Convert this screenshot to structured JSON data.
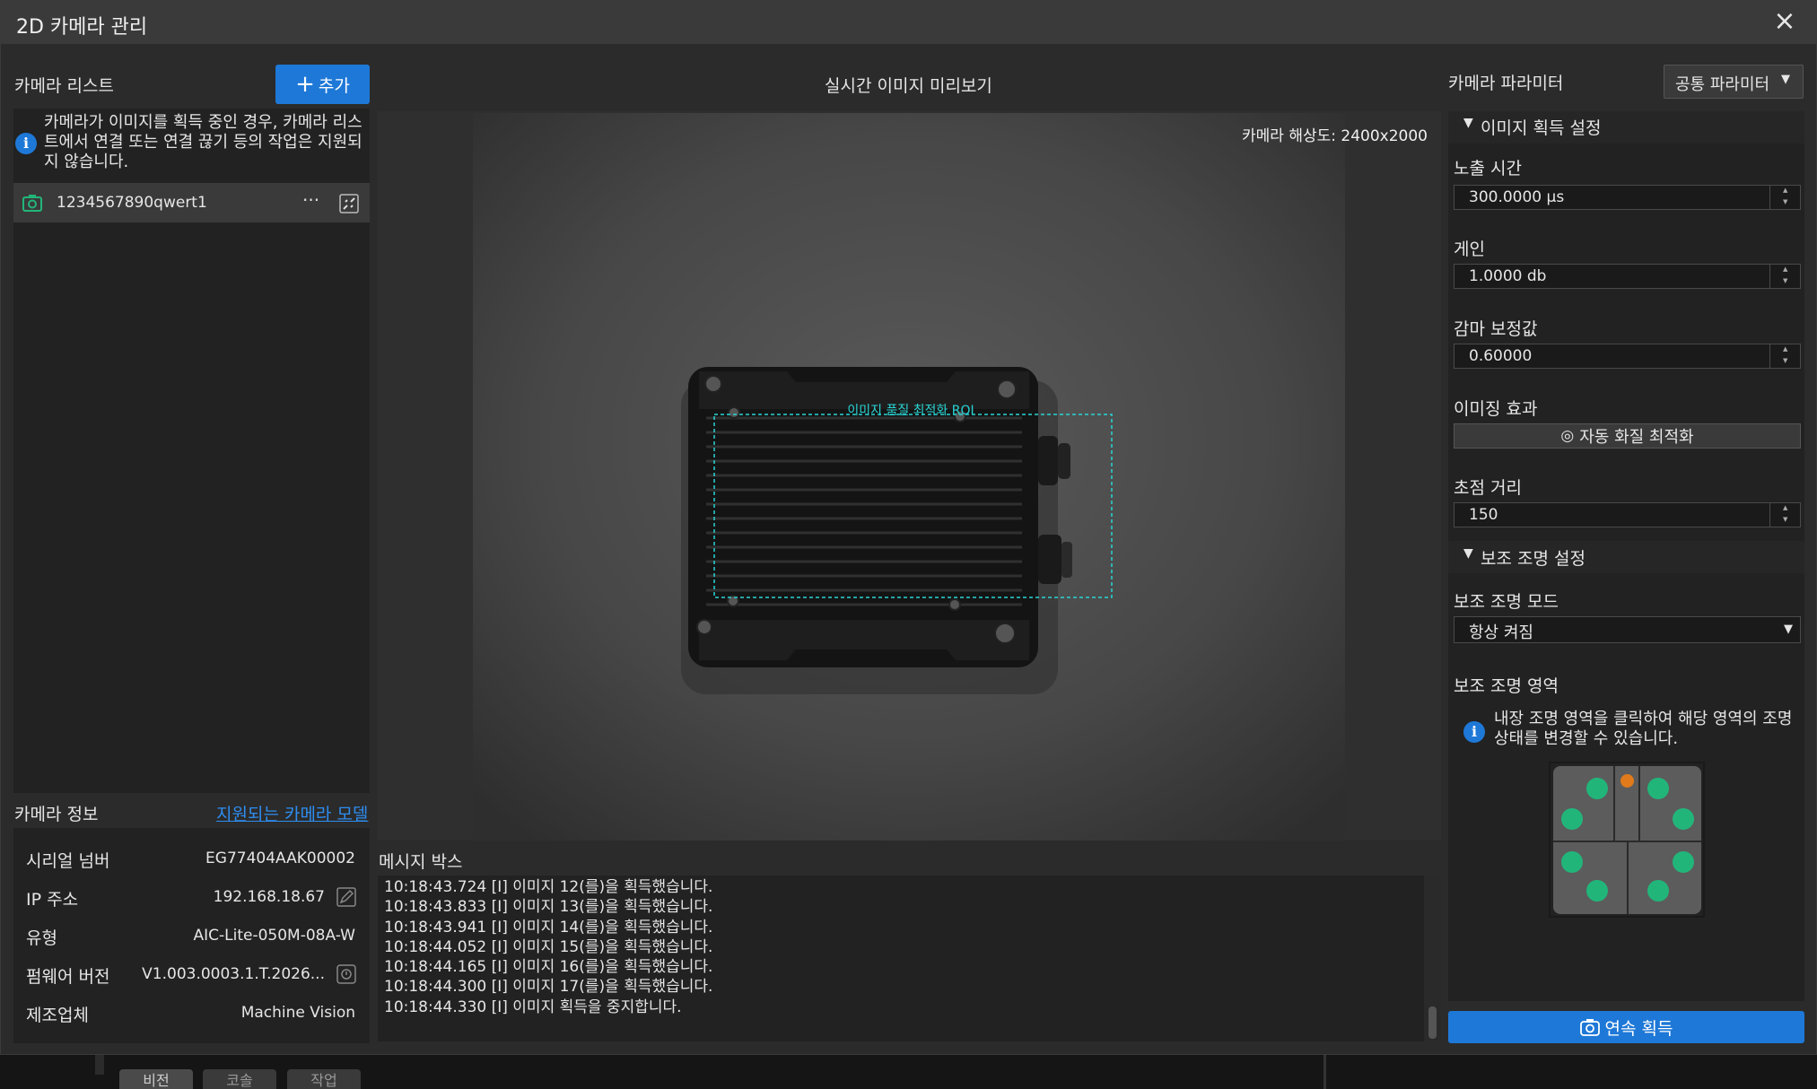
{
  "window": {
    "title": "2D 카메라 관리",
    "close_icon": "×"
  },
  "camera_list": {
    "heading": "카메라 리스트",
    "add_button": "추가",
    "info_text": "카메라가 이미지를 획득 중인 경우, 카메라 리스트에서 연결 또는 연결 끊기 등의 작업은 지원되지 않습니다.",
    "items": [
      {
        "name": "1234567890qwert1",
        "menu": "···"
      }
    ]
  },
  "camera_info": {
    "heading": "카메라 정보",
    "link": "지원되는 카메라 모델",
    "rows": [
      {
        "label": "시리얼 넘버",
        "value": "EG77404AAK00002"
      },
      {
        "label": "IP 주소",
        "value": "192.168.18.67"
      },
      {
        "label": "유형",
        "value": "AIC-Lite-050M-08A-W"
      },
      {
        "label": "펌웨어 버전",
        "value": "V1.003.0003.1.T.2026..."
      },
      {
        "label": "제조업체",
        "value": "Machine Vision"
      }
    ]
  },
  "preview": {
    "heading": "실시간 이미지 미리보기",
    "resolution": "카메라 해상도: 2400x2000",
    "roi_label": "이미지 품질 최적화 ROI"
  },
  "messages": {
    "heading": "메시지 박스",
    "lines": [
      "10:18:43.724 [I] 이미지 12(를)을 획득했습니다.",
      "10:18:43.833 [I] 이미지 13(를)을 획득했습니다.",
      "10:18:43.941 [I] 이미지 14(를)을 획득했습니다.",
      "10:18:44.052 [I] 이미지 15(를)을 획득했습니다.",
      "10:18:44.165 [I] 이미지 16(를)을 획득했습니다.",
      "10:18:44.300 [I] 이미지 17(를)을 획득했습니다.",
      "10:18:44.330 [I] 이미지 획득을 중지합니다."
    ]
  },
  "params": {
    "heading": "카메라 파라미터",
    "dropdown": "공통 파라미터",
    "acq_section": "이미지 획득 설정",
    "exposure_label": "노출 시간",
    "exposure_value": "300.0000 μs",
    "gain_label": "게인",
    "gain_value": "1.0000 db",
    "gamma_label": "감마 보정값",
    "gamma_value": "0.60000",
    "effect_label": "이미징 효과",
    "auto_button": "자동 화질 최적화",
    "focus_label": "초점 거리",
    "focus_value": "150",
    "light_section": "보조 조명 설정",
    "light_mode_label": "보조 조명 모드",
    "light_mode_value": "항상 켜짐",
    "light_area_label": "보조 조명 영역",
    "light_info": "내장 조명 영역을 클릭하여 해당 영역의 조명 상태를 변경할 수 있습니다.",
    "continuous_button": "연속 획득"
  },
  "background_tabs": [
    "비전",
    "코솔",
    "작업"
  ],
  "colors": {
    "accent": "#1e78d7",
    "roi": "#2ad4d4",
    "led_on": "#22b57a",
    "led_status": "#e07a1a"
  }
}
